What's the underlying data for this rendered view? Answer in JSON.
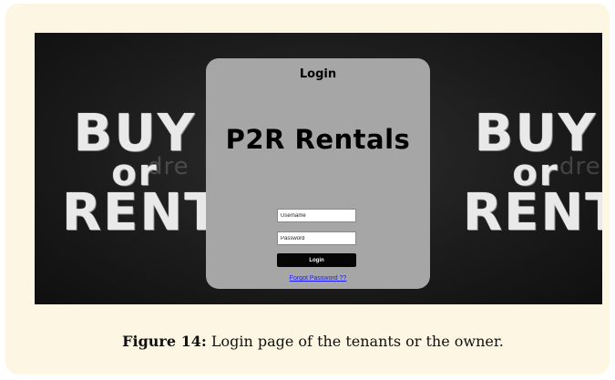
{
  "screen": {
    "left_art": {
      "line1": "BUY",
      "line2": "or",
      "line3": "RENT",
      "watermark": "dre"
    },
    "right_art": {
      "line1": "BUY",
      "line2": "or",
      "line3": "RENT",
      "watermark": "dre"
    }
  },
  "login_card": {
    "title": "Login",
    "brand": "P2R Rentals",
    "username_placeholder": "Username",
    "password_placeholder": "Password",
    "login_button": "Login",
    "forgot_link": "Forgot Password ??"
  },
  "caption": {
    "label": "Figure 14:",
    "text": " Login page of the tenants or the owner."
  }
}
